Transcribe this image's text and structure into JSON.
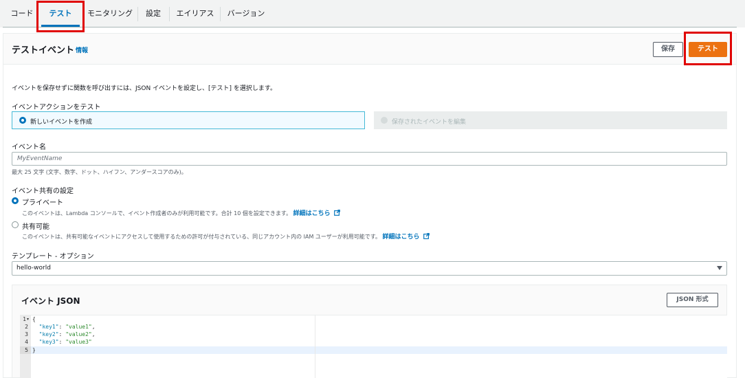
{
  "tabs": [
    "コード",
    "テスト",
    "モニタリング",
    "設定",
    "エイリアス",
    "バージョン"
  ],
  "header": {
    "title": "テストイベント",
    "info": "情報",
    "save_label": "保存",
    "test_label": "テスト"
  },
  "intro": "イベントを保存せずに関数を呼び出すには、JSON イベントを設定し、[テスト] を選択します。",
  "action": {
    "label": "イベントアクションをテスト",
    "new_event": "新しいイベントを作成",
    "edit_saved": "保存されたイベントを編集"
  },
  "event_name": {
    "label": "イベント名",
    "placeholder": "MyEventName",
    "hint": "最大 25 文字 (文字、数字、ドット、ハイフン、アンダースコアのみ)。"
  },
  "sharing": {
    "label": "イベント共有の設定",
    "private_label": "プライベート",
    "private_desc": "このイベントは、Lambda コンソールで、イベント作成者のみが利用可能です。合計 10 個を設定できます。",
    "shareable_label": "共有可能",
    "shareable_desc": "このイベントは、共有可能なイベントにアクセスして使用するための許可が付与されている、同じアカウント内の IAM ユーザーが利用可能です。",
    "learn_more": "詳細はこちら"
  },
  "template": {
    "label": "テンプレート - オプション",
    "value": "hello-world"
  },
  "json_panel": {
    "title": "イベント JSON",
    "format_button": "JSON 形式",
    "line_numbers": [
      "1",
      "2",
      "3",
      "4",
      "5"
    ],
    "lines": [
      {
        "text": "{"
      },
      {
        "key": "\"key1\"",
        "val": "\"value1\"",
        "comma": ","
      },
      {
        "key": "\"key2\"",
        "val": "\"value2\"",
        "comma": ","
      },
      {
        "key": "\"key3\"",
        "val": "\"value3\"",
        "comma": ""
      },
      {
        "text": "}"
      }
    ]
  },
  "colors": {
    "accent": "#0073bb",
    "primary_button": "#ec7211",
    "highlight_box": "#e00000"
  }
}
